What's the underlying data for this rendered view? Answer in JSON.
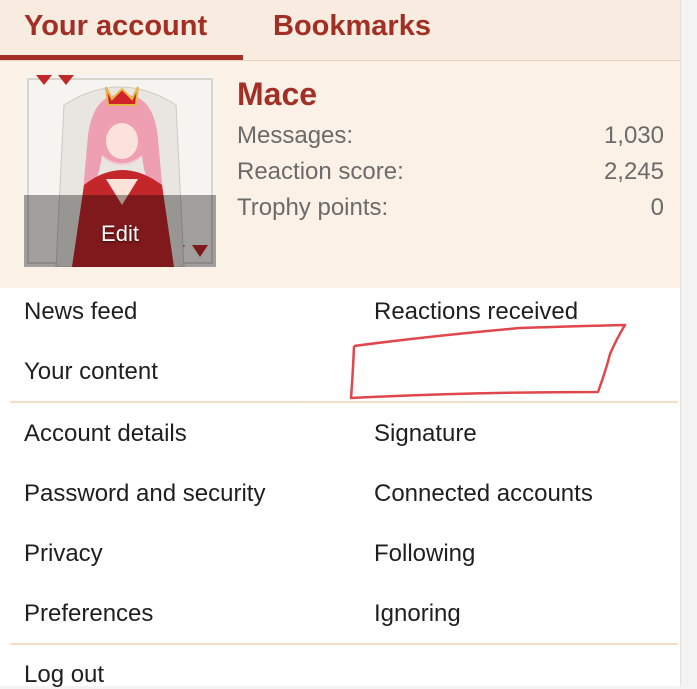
{
  "tabs": {
    "your_account": "Your account",
    "bookmarks": "Bookmarks"
  },
  "profile": {
    "username": "Mace",
    "avatar_edit": "Edit",
    "stats": [
      {
        "label": "Messages:",
        "value": "1,030"
      },
      {
        "label": "Reaction score:",
        "value": "2,245"
      },
      {
        "label": "Trophy points:",
        "value": "0"
      }
    ]
  },
  "links": {
    "news_feed": "News feed",
    "reactions_received": "Reactions received",
    "your_content": "Your content",
    "account_details": "Account details",
    "signature": "Signature",
    "password_security": "Password and security",
    "connected_accounts": "Connected accounts",
    "privacy": "Privacy",
    "following": "Following",
    "preferences": "Preferences",
    "ignoring": "Ignoring",
    "log_out": "Log out"
  },
  "colors": {
    "accent": "#a12f25",
    "header_bg": "#f7ecdf",
    "profile_bg": "#fbf1e6",
    "annotation": "#e0474c"
  }
}
